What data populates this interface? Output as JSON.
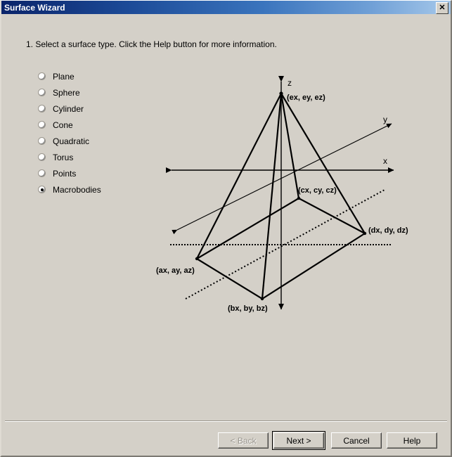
{
  "window": {
    "title": "Surface Wizard",
    "close_label": "✕",
    "close_icon": "close-icon"
  },
  "instruction": "1.  Select a surface type.  Click the Help button for more information.",
  "surface_types": [
    {
      "label": "Plane",
      "selected": false
    },
    {
      "label": "Sphere",
      "selected": false
    },
    {
      "label": "Cylinder",
      "selected": false
    },
    {
      "label": "Cone",
      "selected": false
    },
    {
      "label": "Quadratic",
      "selected": false
    },
    {
      "label": "Torus",
      "selected": false
    },
    {
      "label": "Points",
      "selected": false
    },
    {
      "label": "Macrobodies",
      "selected": true
    }
  ],
  "diagram": {
    "axis_labels": {
      "x": "x",
      "y": "y",
      "z": "z"
    },
    "vertex_labels": {
      "a": "(ax, ay, az)",
      "b": "(bx, by, bz)",
      "c": "(cx, cy, cz)",
      "d": "(dx, dy, dz)",
      "e": "(ex, ey, ez)"
    }
  },
  "buttons": {
    "back": "< Back",
    "next": "Next >",
    "cancel": "Cancel",
    "help": "Help"
  },
  "colors": {
    "dialog_face": "#d4d0c8",
    "title_start": "#0a246a",
    "title_end": "#a6c8ea",
    "text": "#000000",
    "disabled_text": "#9a968e"
  }
}
